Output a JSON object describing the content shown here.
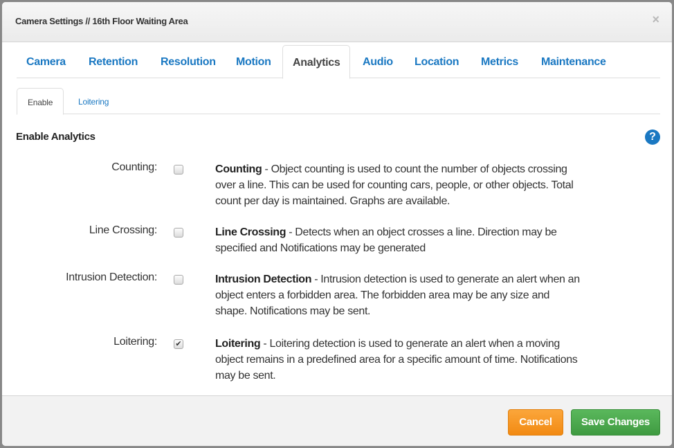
{
  "modal": {
    "title": "Camera Settings // 16th Floor Waiting Area",
    "close_icon": "×"
  },
  "tabs": [
    {
      "label": "Camera",
      "active": false
    },
    {
      "label": "Retention",
      "active": false
    },
    {
      "label": "Resolution",
      "active": false
    },
    {
      "label": "Motion",
      "active": false
    },
    {
      "label": "Analytics",
      "active": true
    },
    {
      "label": "Audio",
      "active": false
    },
    {
      "label": "Location",
      "active": false
    },
    {
      "label": "Metrics",
      "active": false
    },
    {
      "label": "Maintenance",
      "active": false
    }
  ],
  "subtabs": [
    {
      "label": "Enable",
      "active": true
    },
    {
      "label": "Loitering",
      "active": false
    }
  ],
  "section": {
    "title": "Enable Analytics",
    "help_icon": "?"
  },
  "analytics": [
    {
      "label": "Counting:",
      "checked": false,
      "title": "Counting",
      "description": " - Object counting is used to count the number of objects crossing over a line. This can be used for counting cars, people, or other objects. Total count per day is maintained. Graphs are available."
    },
    {
      "label": "Line Crossing:",
      "checked": false,
      "title": "Line Crossing",
      "description": " - Detects when an object crosses a line. Direction may be specified and Notifications may be generated"
    },
    {
      "label": "Intrusion Detection:",
      "checked": false,
      "title": "Intrusion Detection",
      "description": " - Intrusion detection is used to generate an alert when an object enters a forbidden area. The forbidden area may be any size and shape. Notifications may be sent."
    },
    {
      "label": "Loitering:",
      "checked": true,
      "title": "Loitering",
      "description": " - Loitering detection is used to generate an alert when a moving object remains in a predefined area for a specific amount of time. Notifications may be sent."
    }
  ],
  "footer": {
    "cancel_label": "Cancel",
    "save_label": "Save Changes"
  },
  "colors": {
    "link": "#1a78c2",
    "cancel": "#f7941d",
    "save": "#4cae4c"
  }
}
